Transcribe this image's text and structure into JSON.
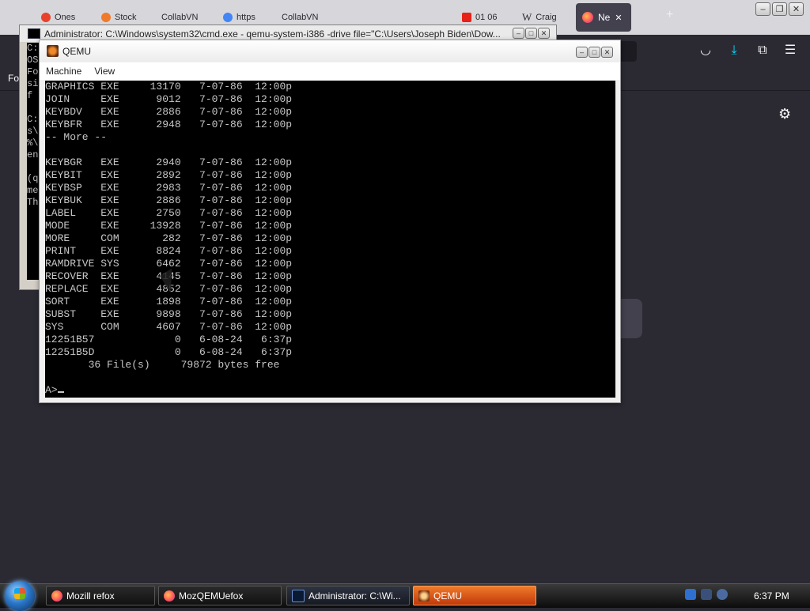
{
  "firefox": {
    "tabs": [
      {
        "label": "Ones",
        "color": "#e8412c"
      },
      {
        "label": "Stock",
        "color": "#f07a2a"
      },
      {
        "label": "CollabVN",
        "color": ""
      },
      {
        "label": "https",
        "color": "#4285f4"
      },
      {
        "label": "CollabVN",
        "color": ""
      },
      {
        "label": "01 06",
        "color": "#e62117"
      },
      {
        "label": "Craig",
        "color": ""
      }
    ],
    "active_tab_label": "Ne",
    "active_tab_close": "✕",
    "new_tab": "+",
    "bookmarks_fragment": "Fo",
    "gear": "⚙"
  },
  "cmd_window": {
    "title": "Administrator: C:\\Windows\\system32\\cmd.exe - qemu-system-i386  -drive file=\"C:\\Users\\Joseph Biden\\Dow...",
    "console_lines": [
      "C:",
      "OS",
      "Fo",
      "si",
      "f",
      "",
      "C:",
      "s\\",
      "%\\",
      "en",
      "",
      "(q",
      "me",
      "Th"
    ]
  },
  "qemu_window": {
    "title": "QEMU",
    "menu": [
      "Machine",
      "View"
    ],
    "dos_lines": [
      "GRAPHICS EXE     13170   7-07-86  12:00p",
      "JOIN     EXE      9012   7-07-86  12:00p",
      "KEYBDV   EXE      2886   7-07-86  12:00p",
      "KEYBFR   EXE      2948   7-07-86  12:00p",
      "-- More --",
      "",
      "KEYBGR   EXE      2940   7-07-86  12:00p",
      "KEYBIT   EXE      2892   7-07-86  12:00p",
      "KEYBSP   EXE      2983   7-07-86  12:00p",
      "KEYBUK   EXE      2886   7-07-86  12:00p",
      "LABEL    EXE      2750   7-07-86  12:00p",
      "MODE     EXE     13928   7-07-86  12:00p",
      "MORE     COM       282   7-07-86  12:00p",
      "PRINT    EXE      8824   7-07-86  12:00p",
      "RAMDRIVE SYS      6462   7-07-86  12:00p",
      "RECOVER  EXE      4145   7-07-86  12:00p",
      "REPLACE  EXE      4852   7-07-86  12:00p",
      "SORT     EXE      1898   7-07-86  12:00p",
      "SUBST    EXE      9898   7-07-86  12:00p",
      "SYS      COM      4607   7-07-86  12:00p",
      "12251B57             0   6-08-24   6:37p",
      "12251B5D             0   6-08-24   6:37p",
      "       36 File(s)     79872 bytes free",
      ""
    ],
    "prompt": "A>"
  },
  "taskbar": {
    "buttons": [
      {
        "label": "Mozill refox",
        "kind": "firefox"
      },
      {
        "label": "MozQEMUefox",
        "kind": "firefox"
      },
      {
        "label": "Administrator: C:\\Wi...",
        "kind": "cmd"
      },
      {
        "label": "QEMU",
        "kind": "qemu"
      }
    ],
    "clock": "6:37 PM"
  }
}
